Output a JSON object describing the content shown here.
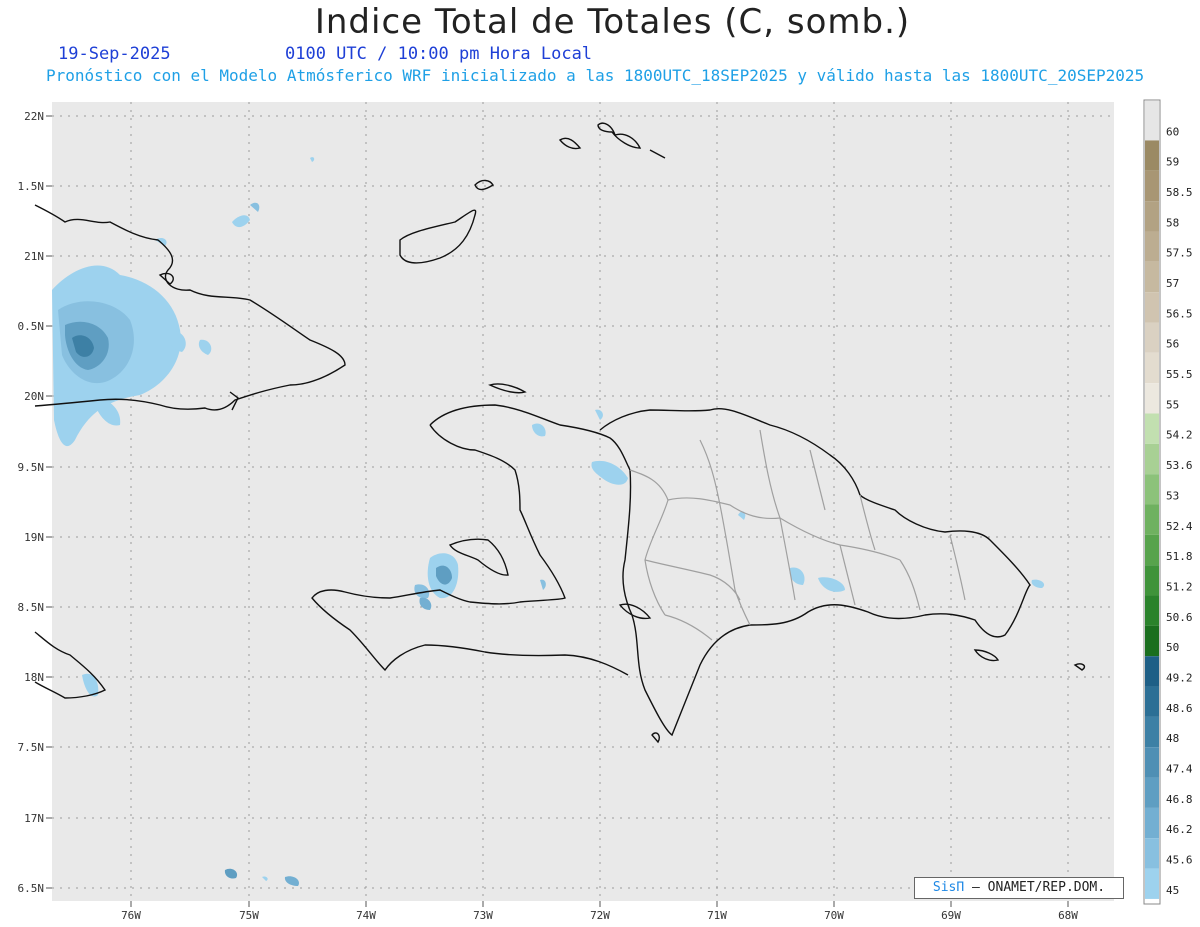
{
  "header": {
    "title": "Indice Total de Totales (C, somb.)",
    "date": "19-Sep-2025",
    "time_label": "0100 UTC / 10:00 pm Hora Local",
    "model_info": "Pronóstico con el Modelo Atmósferico WRF inicializado a las 1800UTC_18SEP2025 y válido hasta las  1800UTC_20SEP2025"
  },
  "axes": {
    "lat_labels": [
      "22N",
      "1.5N",
      "21N",
      "0.5N",
      "20N",
      "9.5N",
      "19N",
      "8.5N",
      "18N",
      "7.5N",
      "17N",
      "6.5N"
    ],
    "lon_labels": [
      "76W",
      "75W",
      "74W",
      "73W",
      "72W",
      "71W",
      "70W",
      "69W",
      "68W"
    ]
  },
  "colorbar": {
    "labels": [
      "60",
      "59",
      "58.5",
      "58",
      "57.5",
      "57",
      "56.5",
      "56",
      "55.5",
      "55",
      "54.2",
      "53.6",
      "53",
      "52.4",
      "51.8",
      "51.2",
      "50.6",
      "50",
      "49.2",
      "48.6",
      "48",
      "47.4",
      "46.8",
      "46.2",
      "45.6",
      "45"
    ],
    "colors": [
      "#e6e6e6",
      "#9b8a64",
      "#a89674",
      "#b2a283",
      "#bcad91",
      "#c6b9a0",
      "#d0c4b0",
      "#dad1c2",
      "#e3dccf",
      "#ece8df",
      "#c2e0b0",
      "#a8d094",
      "#8cc27a",
      "#6fb160",
      "#57a34c",
      "#3f933a",
      "#2a822b",
      "#1a6e1e",
      "#1e5f86",
      "#2c6f95",
      "#3d80a5",
      "#4f8fb4",
      "#5f9ec2",
      "#73afd2",
      "#88c0e0",
      "#9dd2ee"
    ]
  },
  "credit": {
    "sis": "SisΠ",
    "org": "– ONAMET/REP.DOM."
  }
}
